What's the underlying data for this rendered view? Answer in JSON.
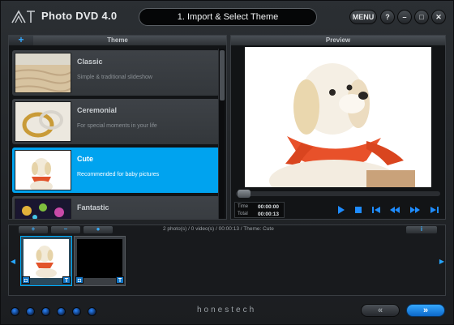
{
  "app": {
    "title": "Photo DVD 4.0",
    "step": "1. Import & Select Theme"
  },
  "window_buttons": {
    "menu": "MENU",
    "help": "?",
    "minimize": "–",
    "maximize": "□",
    "close": "✕"
  },
  "theme_panel": {
    "header": "Theme",
    "add_label": "+",
    "items": [
      {
        "name": "Classic",
        "description": "Simple & traditional slideshow"
      },
      {
        "name": "Ceremonial",
        "description": "For special moments in your life"
      },
      {
        "name": "Cute",
        "description": "Recommended for baby pictures",
        "selected": true
      },
      {
        "name": "Fantastic",
        "description": ""
      }
    ]
  },
  "preview_panel": {
    "header": "Preview",
    "time_label": "Time",
    "total_label": "Total",
    "time_value": "00:00:00",
    "total_value": "00:00:13",
    "progress": 0
  },
  "storyboard": {
    "add_label": "+",
    "remove_label": "–",
    "record_label": "●",
    "info": "2 photo(s) / 0 video(s) / 00:00:13 / Theme: Cute",
    "help_label": "i",
    "text_tool_label": "T"
  },
  "footer": {
    "brand": "honestech",
    "back_label": "«",
    "next_label": "»"
  },
  "colors": {
    "accent": "#00a3ef",
    "selected_bg": "#00a3ef",
    "icon_blue": "#1e8cff"
  }
}
